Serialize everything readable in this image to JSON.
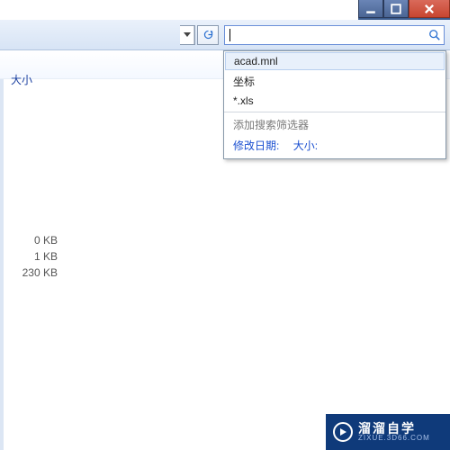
{
  "window_controls": {
    "min": "minimize",
    "max": "maximize",
    "close": "close"
  },
  "column_header": "大小",
  "search": {
    "value": "",
    "placeholder": ""
  },
  "suggestions": {
    "items": [
      "acad.mnl",
      "坐标",
      "*.xls"
    ],
    "hint": "添加搜索筛选器",
    "filters": {
      "date": "修改日期:",
      "size": "大小:"
    }
  },
  "file_sizes": [
    "0 KB",
    "1 KB",
    "230 KB"
  ],
  "watermark": {
    "title": "溜溜自学",
    "sub": "ZIXUE.3D66.COM"
  }
}
